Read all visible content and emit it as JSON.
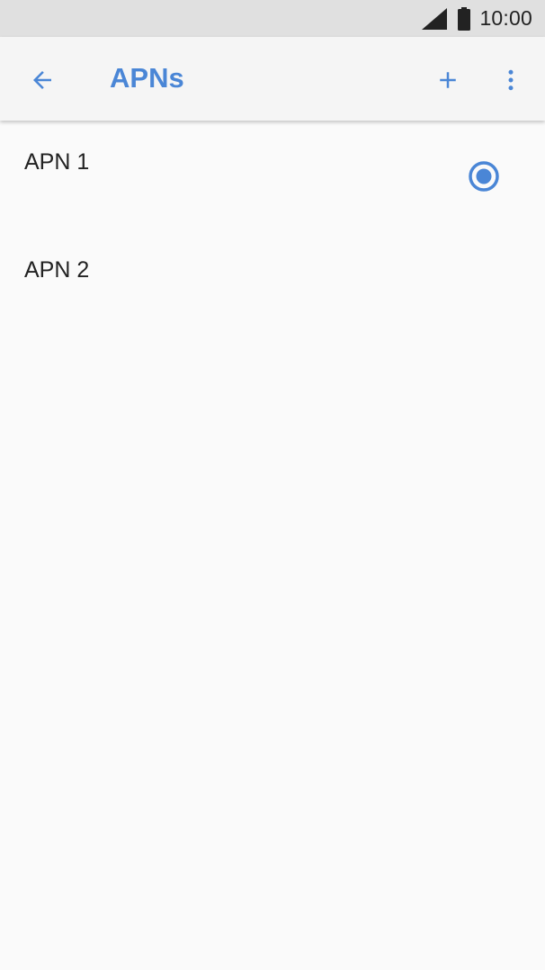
{
  "status_bar": {
    "time": "10:00",
    "icons": [
      "signal-icon",
      "battery-icon"
    ]
  },
  "app_bar": {
    "title": "APNs",
    "back_icon": "arrow-back-icon",
    "actions": [
      "add-icon",
      "more-vert-icon"
    ]
  },
  "apns": [
    {
      "name": "APN 1",
      "selected": true
    },
    {
      "name": "APN 2",
      "selected": false
    }
  ],
  "colors": {
    "accent": "#4a86d6",
    "app_bar_bg": "#f5f5f5",
    "status_bar_bg": "#e0e0e0",
    "page_bg": "#fafafa",
    "text": "#222222"
  }
}
